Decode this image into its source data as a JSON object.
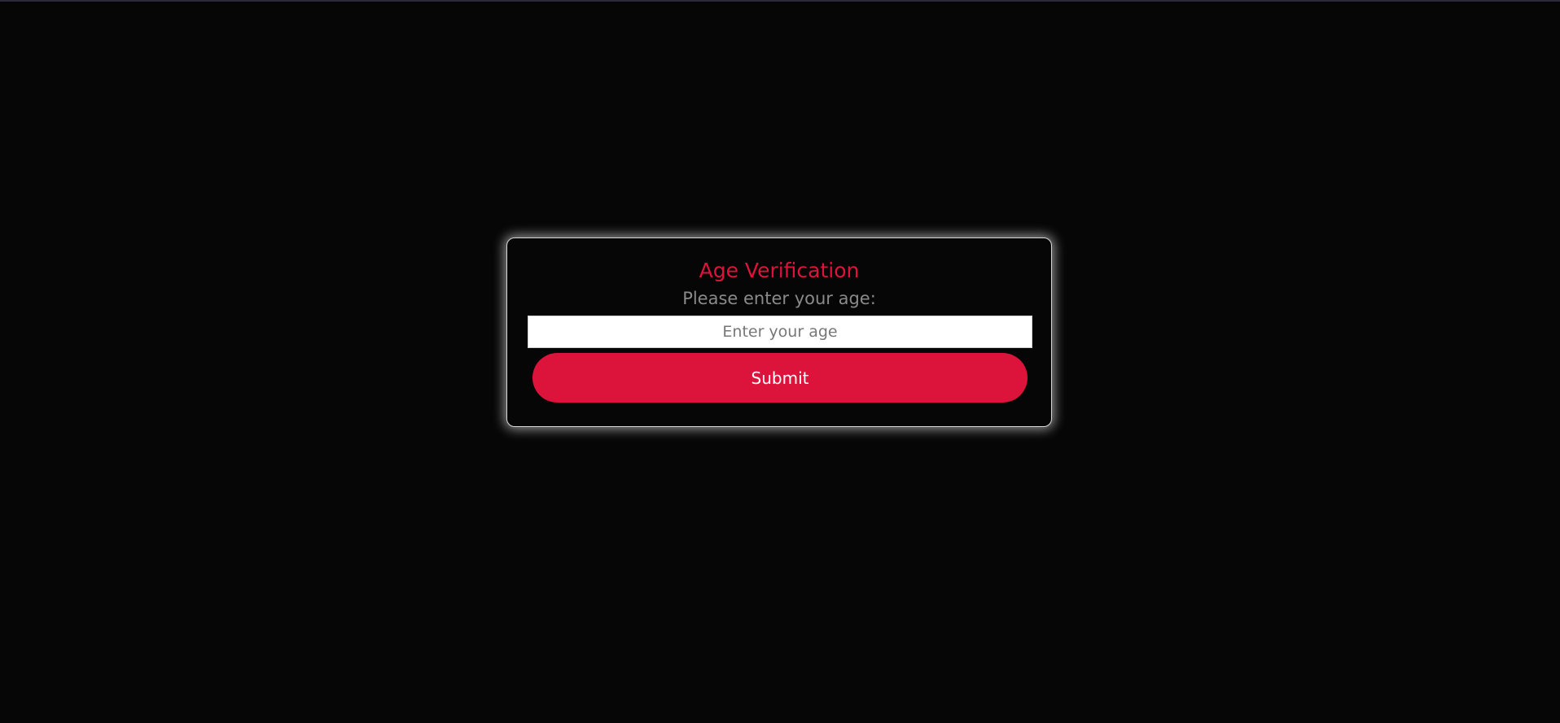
{
  "verification": {
    "title": "Age Verification",
    "prompt": "Please enter your age:",
    "age_input": {
      "value": "",
      "placeholder": "Enter your age"
    },
    "submit_label": "Submit"
  },
  "colors": {
    "background": "#060606",
    "accent": "#dc143c",
    "prompt_text": "#8a8a8a",
    "card_border": "#d8d8d8"
  }
}
